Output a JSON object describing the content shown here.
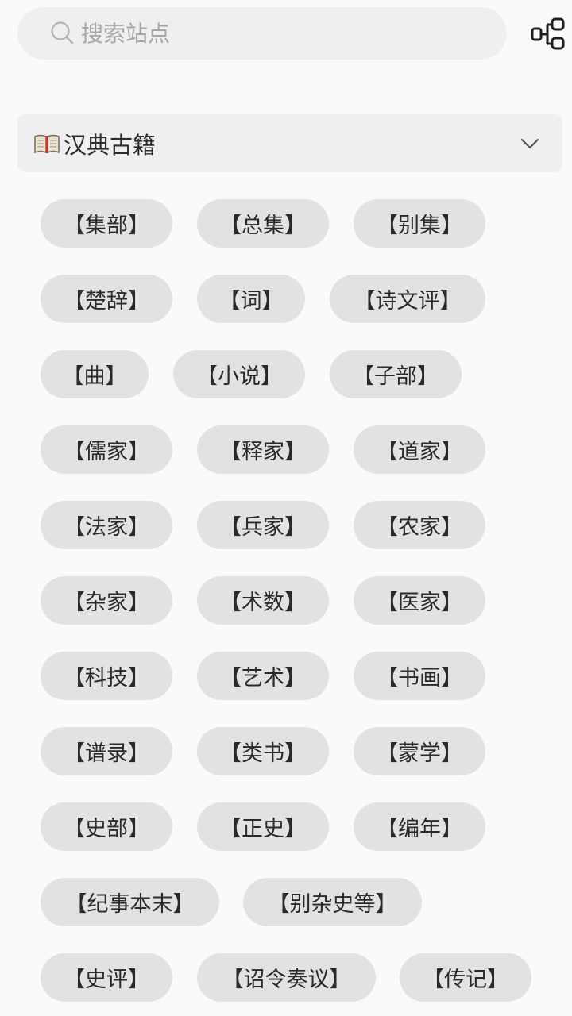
{
  "search": {
    "placeholder": "搜索站点",
    "value": ""
  },
  "group": {
    "title": "汉典古籍"
  },
  "tags": [
    [
      "【集部】",
      "【总集】",
      "【别集】"
    ],
    [
      "【楚辞】",
      "【词】",
      "【诗文评】"
    ],
    [
      "【曲】",
      "【小说】",
      "【子部】"
    ],
    [
      "【儒家】",
      "【释家】",
      "【道家】"
    ],
    [
      "【法家】",
      "【兵家】",
      "【农家】"
    ],
    [
      "【杂家】",
      "【术数】",
      "【医家】"
    ],
    [
      "【科技】",
      "【艺术】",
      "【书画】"
    ],
    [
      "【谱录】",
      "【类书】",
      "【蒙学】"
    ],
    [
      "【史部】",
      "【正史】",
      "【编年】"
    ],
    [
      "【纪事本末】",
      "【别杂史等】"
    ],
    [
      "【史评】",
      "【诏令奏议】",
      "【传记】"
    ]
  ],
  "icons": {
    "search": "search-icon",
    "flow": "flowchart-icon",
    "book": "open-book-icon",
    "chevron": "chevron-down-icon"
  },
  "colors": {
    "background": "#fafafa",
    "field": "#efefef",
    "tag": "#e2e2e2",
    "text": "#2a2a2a",
    "placeholder": "#a6a6a6"
  }
}
